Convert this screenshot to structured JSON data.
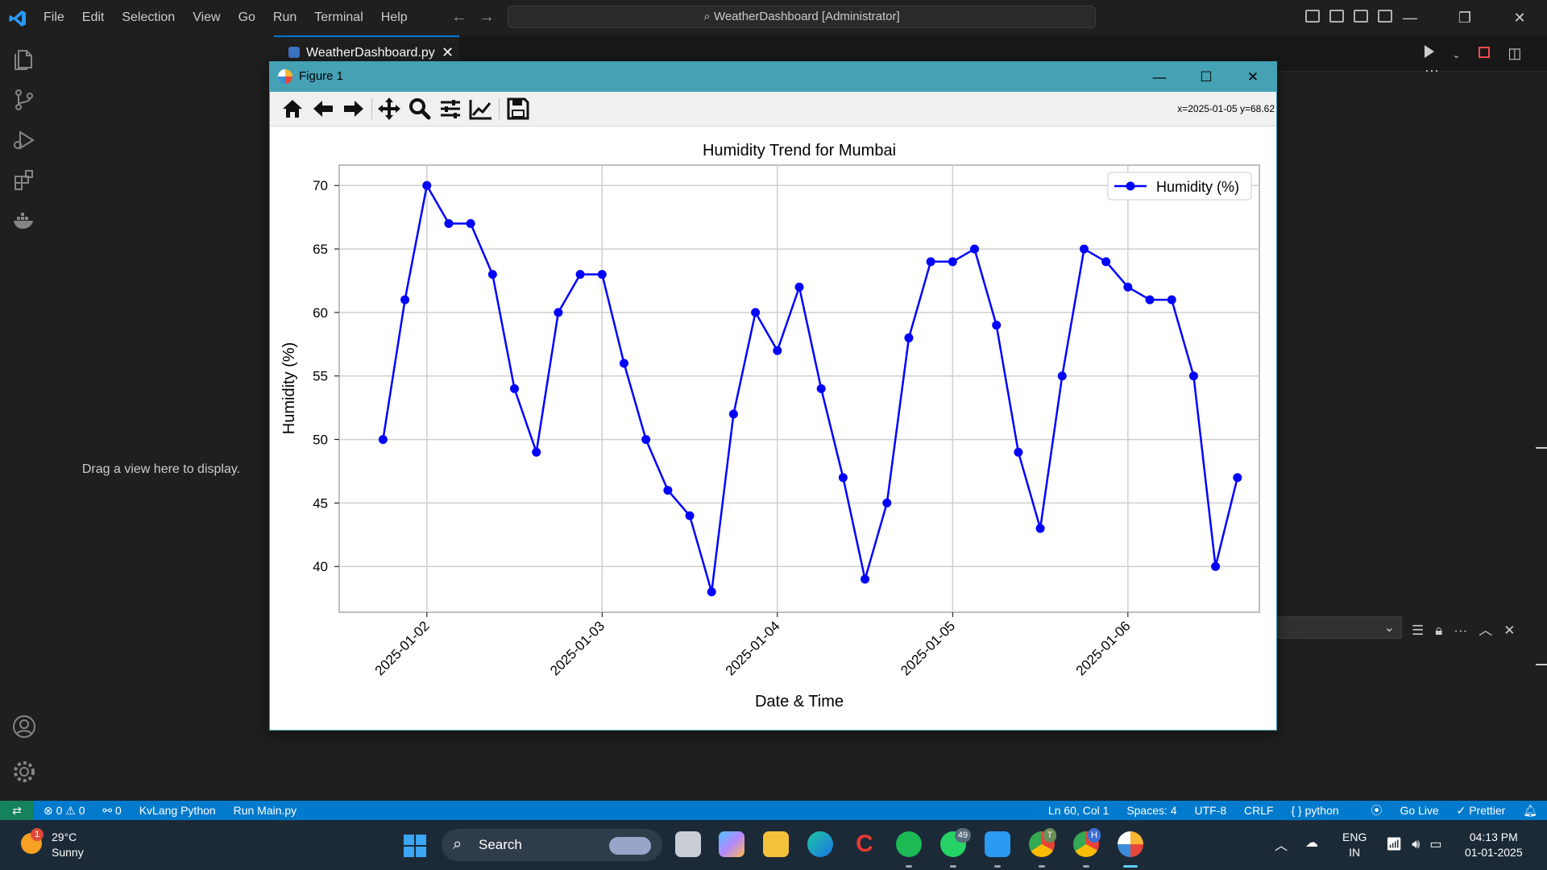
{
  "vscode": {
    "menu": [
      "File",
      "Edit",
      "Selection",
      "View",
      "Go",
      "Run",
      "Terminal",
      "Help"
    ],
    "command_center": "WeatherDashboard [Administrator]",
    "activity_icons": [
      "explorer-icon",
      "source-control-icon",
      "run-debug-icon",
      "extensions-icon",
      "docker-icon",
      "account-icon",
      "settings-gear-icon"
    ],
    "sidebar_hint": "Drag a view here to display.",
    "tab_label": "WeatherDashboard.py",
    "tab_close": "✕"
  },
  "figure_window": {
    "title": "Figure 1",
    "coords": "x=2025-01-05 y=68.62",
    "toolbar_icons": [
      "home-icon",
      "back-icon",
      "forward-icon",
      "pan-icon",
      "zoom-icon",
      "configure-subplots-icon",
      "edit-axis-icon",
      "save-icon"
    ]
  },
  "chart_data": {
    "type": "line",
    "title": "Humidity Trend for Mumbai",
    "xlabel": "Date & Time",
    "ylabel": "Humidity (%)",
    "series": [
      {
        "name": "Humidity (%)",
        "color": "#0000ff",
        "marker": "circle",
        "x": [
          "2025-01-01 18:00",
          "2025-01-01 21:00",
          "2025-01-02 00:00",
          "2025-01-02 03:00",
          "2025-01-02 06:00",
          "2025-01-02 09:00",
          "2025-01-02 12:00",
          "2025-01-02 15:00",
          "2025-01-02 18:00",
          "2025-01-02 21:00",
          "2025-01-03 00:00",
          "2025-01-03 03:00",
          "2025-01-03 06:00",
          "2025-01-03 09:00",
          "2025-01-03 12:00",
          "2025-01-03 15:00",
          "2025-01-03 18:00",
          "2025-01-03 21:00",
          "2025-01-04 00:00",
          "2025-01-04 03:00",
          "2025-01-04 06:00",
          "2025-01-04 09:00",
          "2025-01-04 12:00",
          "2025-01-04 15:00",
          "2025-01-04 18:00",
          "2025-01-04 21:00",
          "2025-01-05 00:00",
          "2025-01-05 03:00",
          "2025-01-05 06:00",
          "2025-01-05 09:00",
          "2025-01-05 12:00",
          "2025-01-05 15:00",
          "2025-01-05 18:00",
          "2025-01-05 21:00",
          "2025-01-06 00:00",
          "2025-01-06 03:00",
          "2025-01-06 06:00",
          "2025-01-06 09:00",
          "2025-01-06 12:00",
          "2025-01-06 15:00"
        ],
        "values": [
          50,
          61,
          70,
          67,
          67,
          63,
          54,
          49,
          60,
          63,
          63,
          56,
          50,
          46,
          44,
          38,
          52,
          60,
          57,
          62,
          54,
          47,
          39,
          45,
          58,
          64,
          64,
          65,
          59,
          49,
          43,
          55,
          65,
          64,
          62,
          61,
          61,
          55,
          40,
          47
        ]
      }
    ],
    "x_ticks": [
      "2025-01-02",
      "2025-01-03",
      "2025-01-04",
      "2025-01-05",
      "2025-01-06"
    ],
    "y_ticks": [
      "40",
      "45",
      "50",
      "55",
      "60",
      "65",
      "70"
    ],
    "ylim": [
      36.4,
      71.6
    ],
    "grid": true,
    "legend_position": "top-right"
  },
  "statusbar": {
    "errors": "⊗ 0 ⚠ 0",
    "ports": "⚯ 0",
    "kvlang": "KvLang Python",
    "run_main": "Run Main.py",
    "cursor": "Ln 60, Col 1",
    "spaces": "Spaces: 4",
    "encoding": "UTF-8",
    "eol": "CRLF",
    "language": "{ } python",
    "golive": "Go Live",
    "prettier": "✓ Prettier"
  },
  "taskbar": {
    "temperature": "29°C",
    "condition": "Sunny",
    "weather_badge": "1",
    "search": "Search",
    "whatsapp_badge": "49",
    "chrome_t_badge": "T",
    "chrome_h_badge": "H",
    "lang1": "ENG",
    "lang2": "IN",
    "time": "04:13 PM",
    "date": "01-01-2025"
  },
  "colors": {
    "accent": "#007acc",
    "figure_titlebar": "#45a2b4",
    "line": "#0000ff"
  }
}
